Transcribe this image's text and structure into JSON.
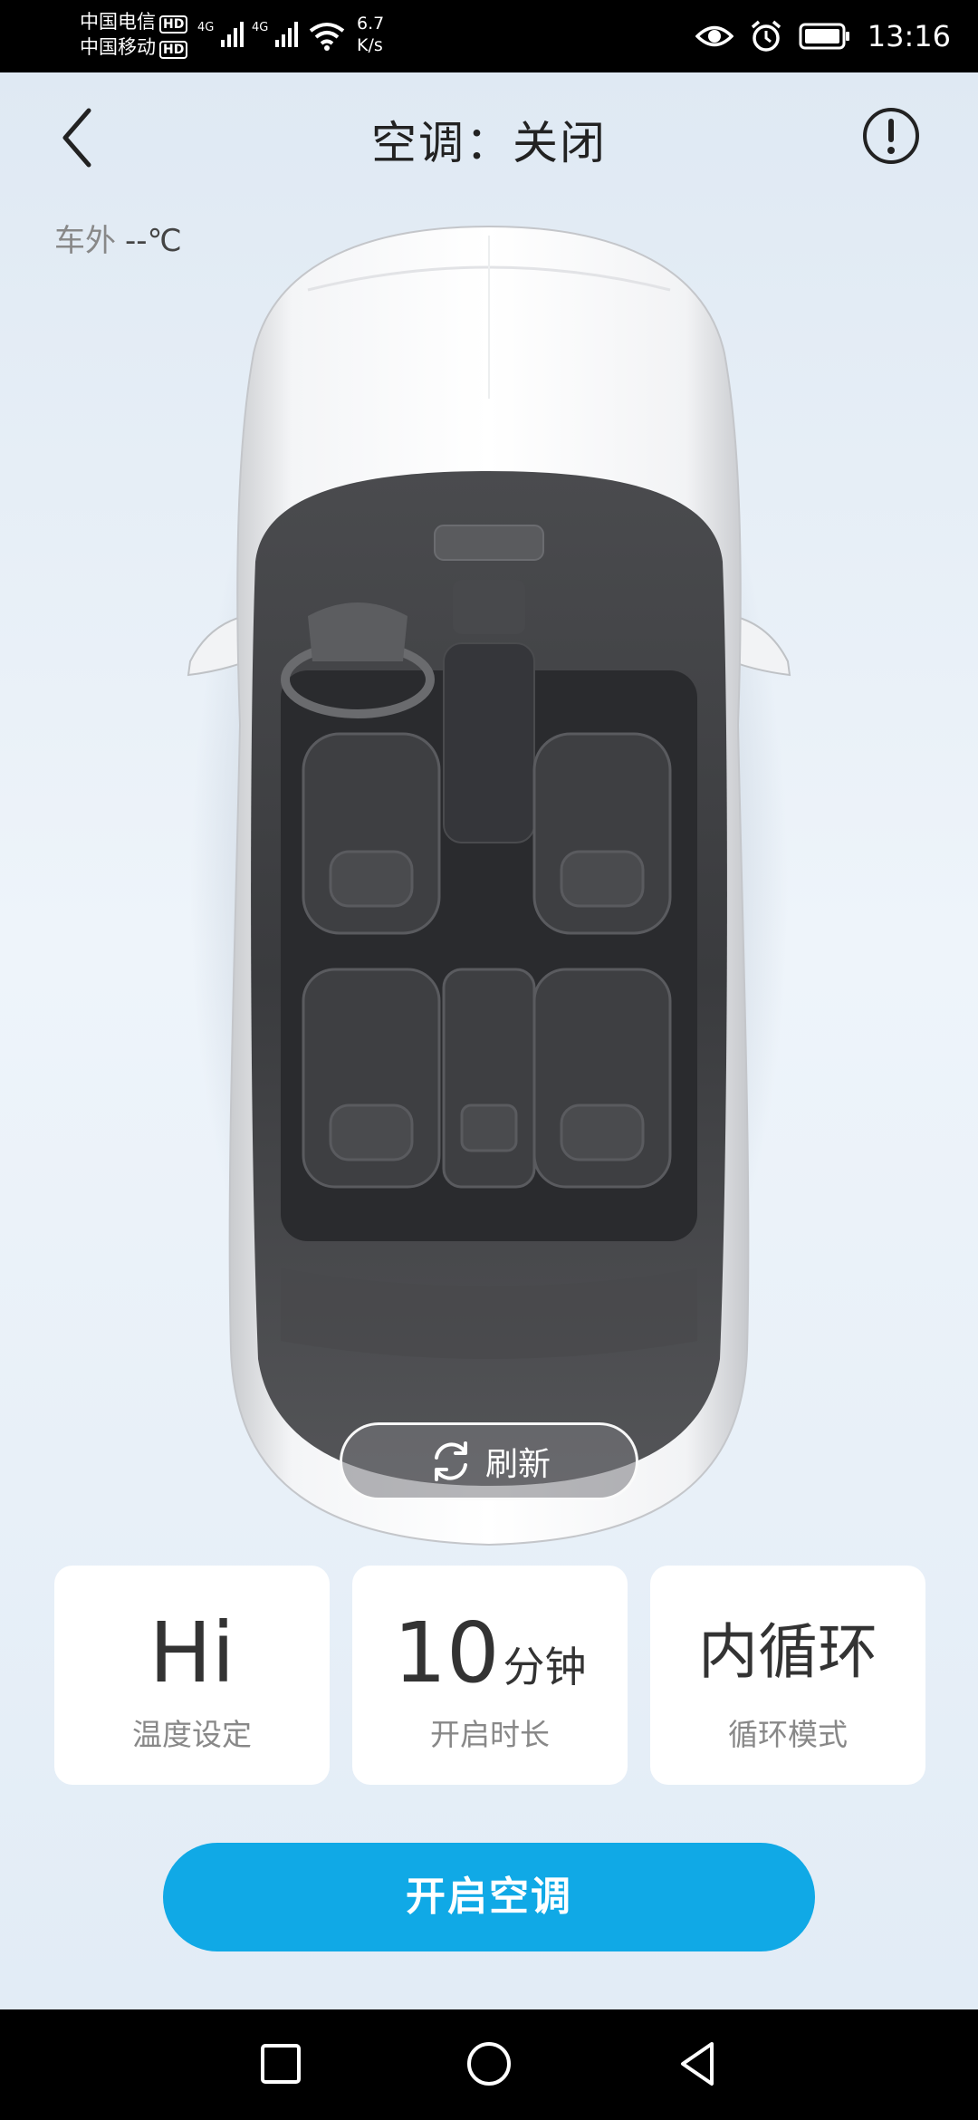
{
  "status_bar": {
    "carrier1": "中国电信",
    "carrier2": "中国移动",
    "hd_badge": "HD",
    "net_type": "4G",
    "speed_value": "6.7",
    "speed_unit": "K/s",
    "time": "13:16"
  },
  "header": {
    "title": "空调：关闭"
  },
  "outside_temp": {
    "label": "车外",
    "value": "--℃"
  },
  "refresh": {
    "label": "刷新"
  },
  "cards": [
    {
      "value": "Hi",
      "unit": "",
      "label": "温度设定"
    },
    {
      "value": "10",
      "unit": "分钟",
      "label": "开启时长"
    },
    {
      "value": "内循环",
      "unit": "",
      "label": "循环模式"
    }
  ],
  "action": {
    "start_label": "开启空调"
  },
  "colors": {
    "accent": "#10a9e6"
  }
}
